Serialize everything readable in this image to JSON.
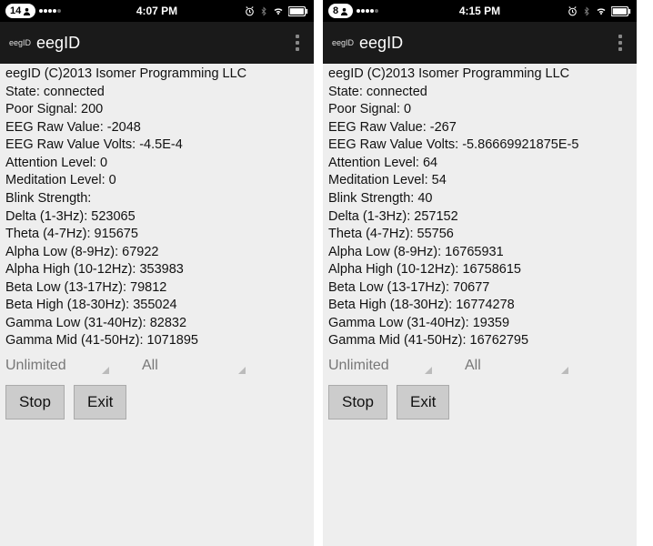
{
  "phones": [
    {
      "status": {
        "badge": "14",
        "time": "4:07 PM"
      },
      "app": {
        "logo": "eegID",
        "title": "eegID"
      },
      "lines": {
        "copyright": "eegID (C)2013 Isomer Programming LLC",
        "state": "State: connected",
        "poor_signal": "Poor Signal: 200",
        "raw": "EEG Raw Value: -2048",
        "raw_volts": "EEG Raw Value Volts: -4.5E-4",
        "attention": "Attention Level: 0",
        "meditation": "Meditation Level: 0",
        "blink": "Blink Strength:",
        "delta": "Delta (1-3Hz): 523065",
        "theta": "Theta (4-7Hz): 915675",
        "alpha_low": "Alpha Low (8-9Hz): 67922",
        "alpha_high": "Alpha High (10-12Hz): 353983",
        "beta_low": "Beta Low (13-17Hz): 79812",
        "beta_high": "Beta High (18-30Hz): 355024",
        "gamma_low": "Gamma Low (31-40Hz): 82832",
        "gamma_mid": "Gamma Mid (41-50Hz): 1071895"
      },
      "spinner1": "Unlimited",
      "spinner2": "All",
      "btn_stop": "Stop",
      "btn_exit": "Exit"
    },
    {
      "status": {
        "badge": "8",
        "time": "4:15 PM"
      },
      "app": {
        "logo": "eegID",
        "title": "eegID"
      },
      "lines": {
        "copyright": "eegID (C)2013 Isomer Programming LLC",
        "state": "State: connected",
        "poor_signal": "Poor Signal: 0",
        "raw": "EEG Raw Value: -267",
        "raw_volts": "EEG Raw Value Volts: -5.86669921875E-5",
        "attention": "Attention Level: 64",
        "meditation": "Meditation Level: 54",
        "blink": "Blink Strength: 40",
        "delta": "Delta (1-3Hz): 257152",
        "theta": "Theta (4-7Hz): 55756",
        "alpha_low": "Alpha Low (8-9Hz): 16765931",
        "alpha_high": "Alpha High (10-12Hz): 16758615",
        "beta_low": "Beta Low (13-17Hz): 70677",
        "beta_high": "Beta High (18-30Hz): 16774278",
        "gamma_low": "Gamma Low (31-40Hz): 19359",
        "gamma_mid": "Gamma Mid (41-50Hz): 16762795"
      },
      "spinner1": "Unlimited",
      "spinner2": "All",
      "btn_stop": "Stop",
      "btn_exit": "Exit"
    }
  ]
}
